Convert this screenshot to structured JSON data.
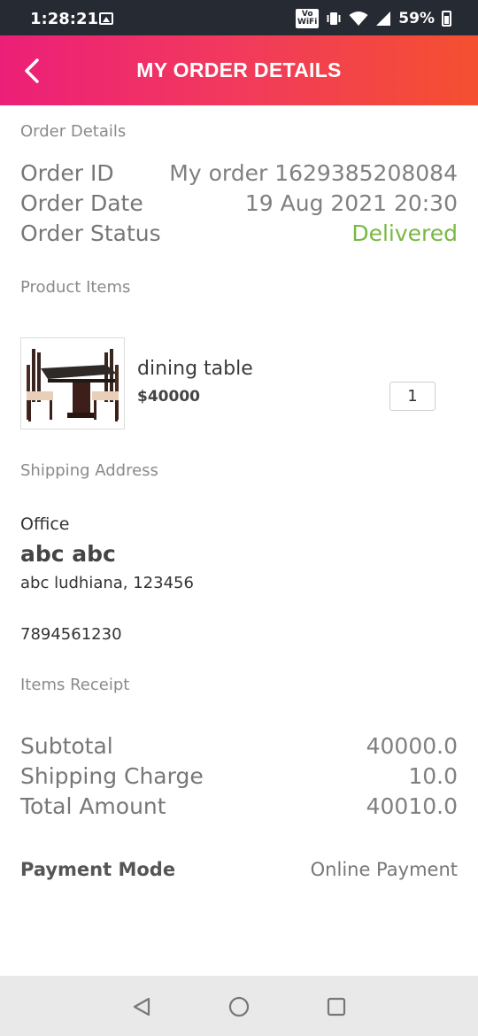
{
  "status_bar": {
    "time": "1:28:21",
    "vowifi_top": "Vo",
    "vowifi_bottom": "WiFi",
    "battery": "59%"
  },
  "header": {
    "title": "MY ORDER DETAILS"
  },
  "order_details": {
    "section_label": "Order Details",
    "order_id_label": "Order ID",
    "order_id_value": "My order 1629385208084",
    "order_date_label": "Order Date",
    "order_date_value": "19 Aug 2021 20:30",
    "order_status_label": "Order Status",
    "order_status_value": "Delivered",
    "status_color": "#78b843"
  },
  "product_items": {
    "section_label": "Product Items",
    "items": [
      {
        "name": "dining table",
        "price": "$40000",
        "quantity": "1"
      }
    ]
  },
  "shipping_address": {
    "section_label": "Shipping Address",
    "type": "Office",
    "name": "abc abc",
    "address": "abc ludhiana, 123456",
    "phone": "7894561230"
  },
  "items_receipt": {
    "section_label": "Items Receipt",
    "subtotal_label": "Subtotal",
    "subtotal_value": "40000.0",
    "shipping_label": "Shipping Charge",
    "shipping_value": "10.0",
    "total_label": "Total Amount",
    "total_value": "40010.0"
  },
  "payment": {
    "label": "Payment Mode",
    "value": "Online Payment"
  },
  "colors": {
    "header_gradient_start": "#ec1f78",
    "header_gradient_end": "#f4502f",
    "status_bar": "#262a33"
  },
  "icons": {
    "back": "chevron-left-icon",
    "nav_back": "triangle-back-icon",
    "nav_home": "circle-home-icon",
    "nav_recents": "square-recents-icon"
  }
}
